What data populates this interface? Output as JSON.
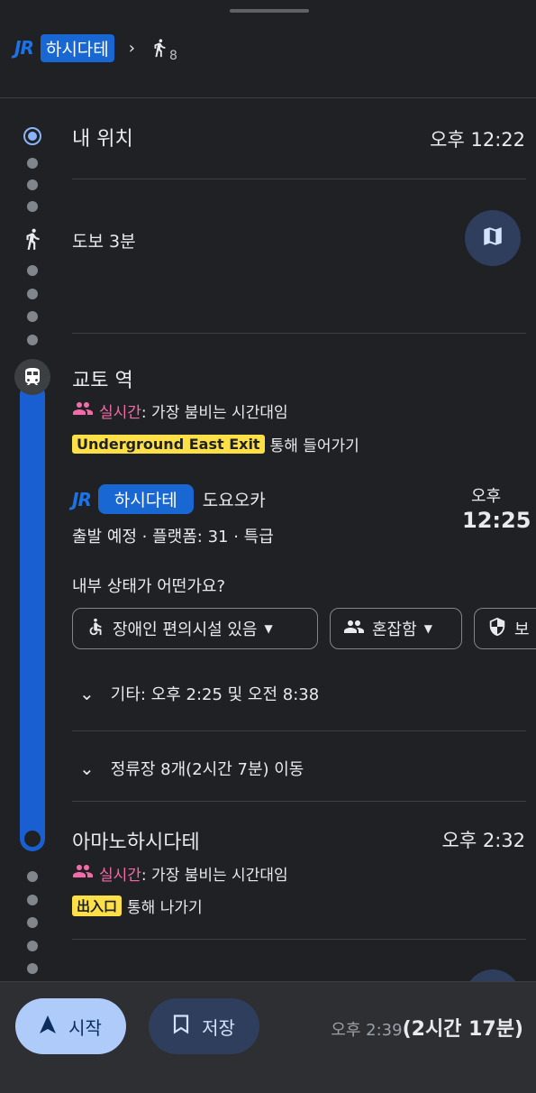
{
  "header": {
    "jr_logo": "JR",
    "line_name": "하시다테",
    "walk_count": "8"
  },
  "start": {
    "title": "내 위치",
    "time": "오후 12:22"
  },
  "walk": {
    "label": "도보 3분"
  },
  "station": {
    "name": "교토 역",
    "realtime_label": "실시간",
    "realtime_text": ": 가장 붐비는 시간대임",
    "exit_badge": "Underground East Exit",
    "exit_text": "통해 들어가기"
  },
  "train": {
    "jr_logo": "JR",
    "line_name": "하시다테",
    "destination": "도요오카",
    "details": "출발 예정 · 플랫폼: 31 · 특급",
    "time_period": "오후",
    "time": "12:25"
  },
  "status_question": "내부 상태가 어떤가요?",
  "chips": [
    {
      "icon": "accessibility-icon",
      "label": "장애인 편의시설 있음"
    },
    {
      "icon": "people-icon",
      "label": "혼잡함"
    },
    {
      "icon": "shield-icon",
      "label": "보"
    }
  ],
  "other_times": "기타: 오후 2:25 및 오전 8:38",
  "stops": "정류장 8개(2시간 7분) 이동",
  "arrival": {
    "name": "아마노하시다테",
    "time": "오후 2:32",
    "realtime_label": "실시간",
    "realtime_text": ": 가장 붐비는 시간대임",
    "exit_badge": "出入口",
    "exit_text": "통해 나가기"
  },
  "bottom": {
    "start_label": "시작",
    "save_label": "저장",
    "arrival_time": "오후 2:39",
    "duration": "(2시간 17분)"
  },
  "colors": {
    "background": "#202124",
    "accent_blue": "#1a73e8",
    "rail_blue": "#1a5fd1",
    "realtime_pink": "#f06ba8",
    "badge_yellow": "#fde047"
  }
}
